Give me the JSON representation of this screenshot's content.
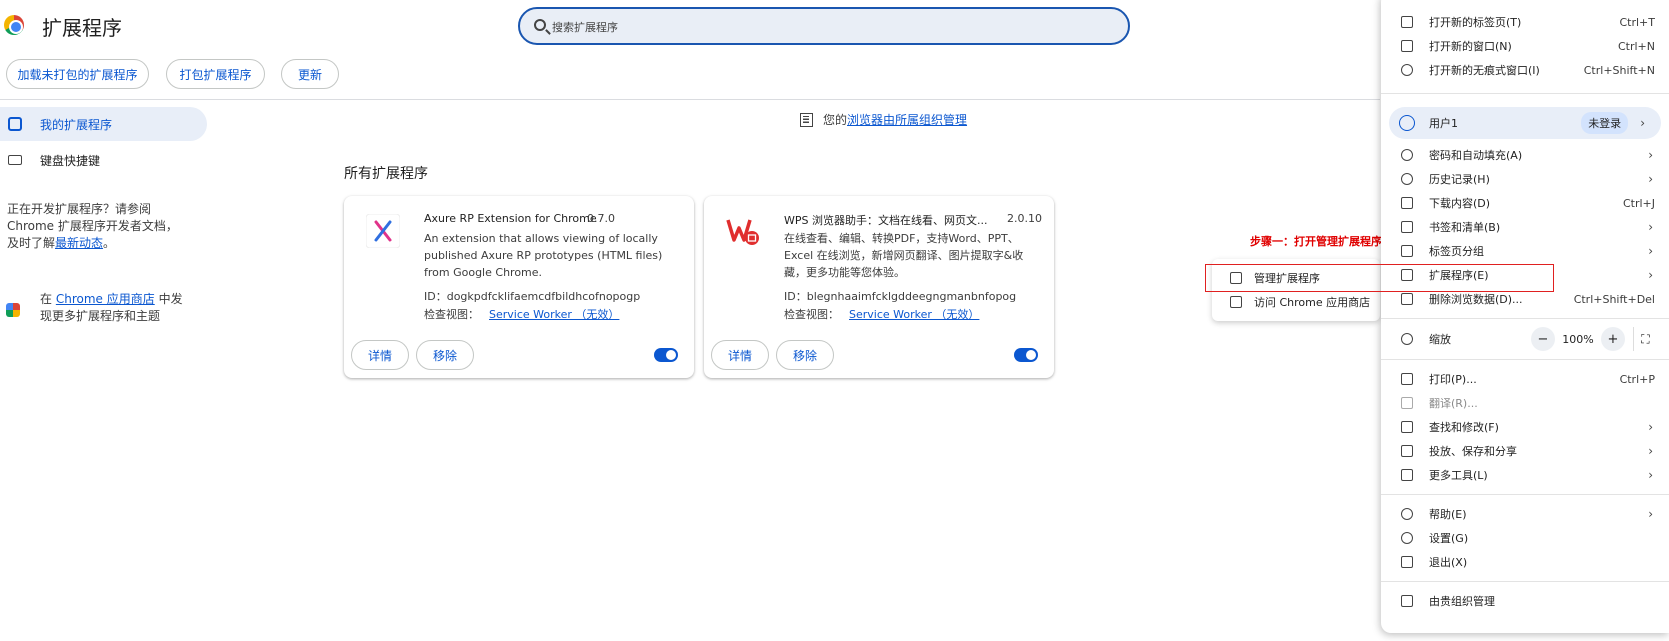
{
  "header": {
    "title": "扩展程序",
    "search_placeholder": "搜索扩展程序"
  },
  "toolbar": {
    "load_unpacked": "加载未打包的扩展程序",
    "pack": "打包扩展程序",
    "update": "更新"
  },
  "sidebar": {
    "items": [
      {
        "label": "我的扩展程序",
        "icon": "puzzle-icon"
      },
      {
        "label": "键盘快捷键",
        "icon": "keyboard-icon"
      }
    ],
    "dev_text_1": "正在开发扩展程序？请参阅",
    "dev_text_2": "Chrome 扩展程序开发者文档，",
    "dev_text_3": "及时了解",
    "dev_link": "最新动态",
    "dev_period": "。",
    "store_prefix": "在",
    "store_link": "Chrome 应用商店",
    "store_suffix_1": "中发",
    "store_suffix_2": "现更多扩展程序和主题"
  },
  "main": {
    "managed_prefix": "您的",
    "managed_link": "浏览器由所属组织管理",
    "section_title": "所有扩展程序",
    "extensions": [
      {
        "name": "Axure RP Extension for Chrome",
        "version": "0.7.0",
        "description": "An extension that allows viewing of locally published Axure RP prototypes (HTML files) from Google Chrome.",
        "id_label": "ID：",
        "id": "dogkpdfcklifaemcdfbildhcofnopogp",
        "inspect_label": "检查视图：",
        "inspect_link": "Service Worker （无效）",
        "details": "详情",
        "remove": "移除",
        "enabled": true
      },
      {
        "name": "WPS 浏览器助手：文档在线看、网页文...",
        "version": "2.0.10",
        "description": "在线查看、编辑、转换PDF，支持Word、PPT、Excel 在线浏览，新增网页翻译、图片提取字&收藏，更多功能等您体验。",
        "id_label": "ID：",
        "id": "blegnhaaimfcklgddeegngmanbnfopog",
        "inspect_label": "检查视图：",
        "inspect_link": "Service Worker （无效）",
        "details": "详情",
        "remove": "移除",
        "enabled": true
      }
    ]
  },
  "annotation": "步骤一：打开管理扩展程序",
  "submenu": {
    "items": [
      {
        "label": "管理扩展程序",
        "icon": "puzzle-icon"
      },
      {
        "label": "访问 Chrome 应用商店",
        "icon": "store-icon"
      }
    ]
  },
  "menu": {
    "items": [
      {
        "label": "打开新的标签页(T)",
        "shortcut": "Ctrl+T"
      },
      {
        "label": "打开新的窗口(N)",
        "shortcut": "Ctrl+N"
      },
      {
        "label": "打开新的无痕式窗口(I)",
        "shortcut": "Ctrl+Shift+N"
      }
    ],
    "user_label": "用户1",
    "user_badge": "未登录",
    "items2": [
      {
        "label": "密码和自动填充(A)",
        "shortcut": "",
        "sub": true
      },
      {
        "label": "历史记录(H)",
        "shortcut": "",
        "sub": true
      },
      {
        "label": "下载内容(D)",
        "shortcut": "Ctrl+J",
        "sub": false
      },
      {
        "label": "书签和清单(B)",
        "shortcut": "",
        "sub": true
      },
      {
        "label": "标签页分组",
        "shortcut": "",
        "sub": true
      },
      {
        "label": "扩展程序(E)",
        "shortcut": "",
        "sub": true
      },
      {
        "label": "删除浏览数据(D)...",
        "shortcut": "Ctrl+Shift+Del",
        "sub": false
      }
    ],
    "zoom_label": "缩放",
    "zoom_minus": "−",
    "zoom_value": "100%",
    "zoom_plus": "+",
    "fullscreen": "⛶",
    "items3": [
      {
        "label": "打印(P)...",
        "shortcut": "Ctrl+P",
        "sub": false
      },
      {
        "label": "翻译(R)...",
        "shortcut": "",
        "sub": false
      },
      {
        "label": "查找和修改(F)",
        "shortcut": "",
        "sub": true
      },
      {
        "label": "投放、保存和分享",
        "shortcut": "",
        "sub": true
      },
      {
        "label": "更多工具(L)",
        "shortcut": "",
        "sub": true
      }
    ],
    "items4": [
      {
        "label": "帮助(E)",
        "shortcut": "",
        "sub": true
      },
      {
        "label": "设置(G)",
        "shortcut": "",
        "sub": false
      },
      {
        "label": "退出(X)",
        "shortcut": "",
        "sub": false
      }
    ],
    "managed": "由贵组织管理"
  },
  "colors": {
    "accent": "#0b57d0",
    "annotation": "#e00000"
  }
}
